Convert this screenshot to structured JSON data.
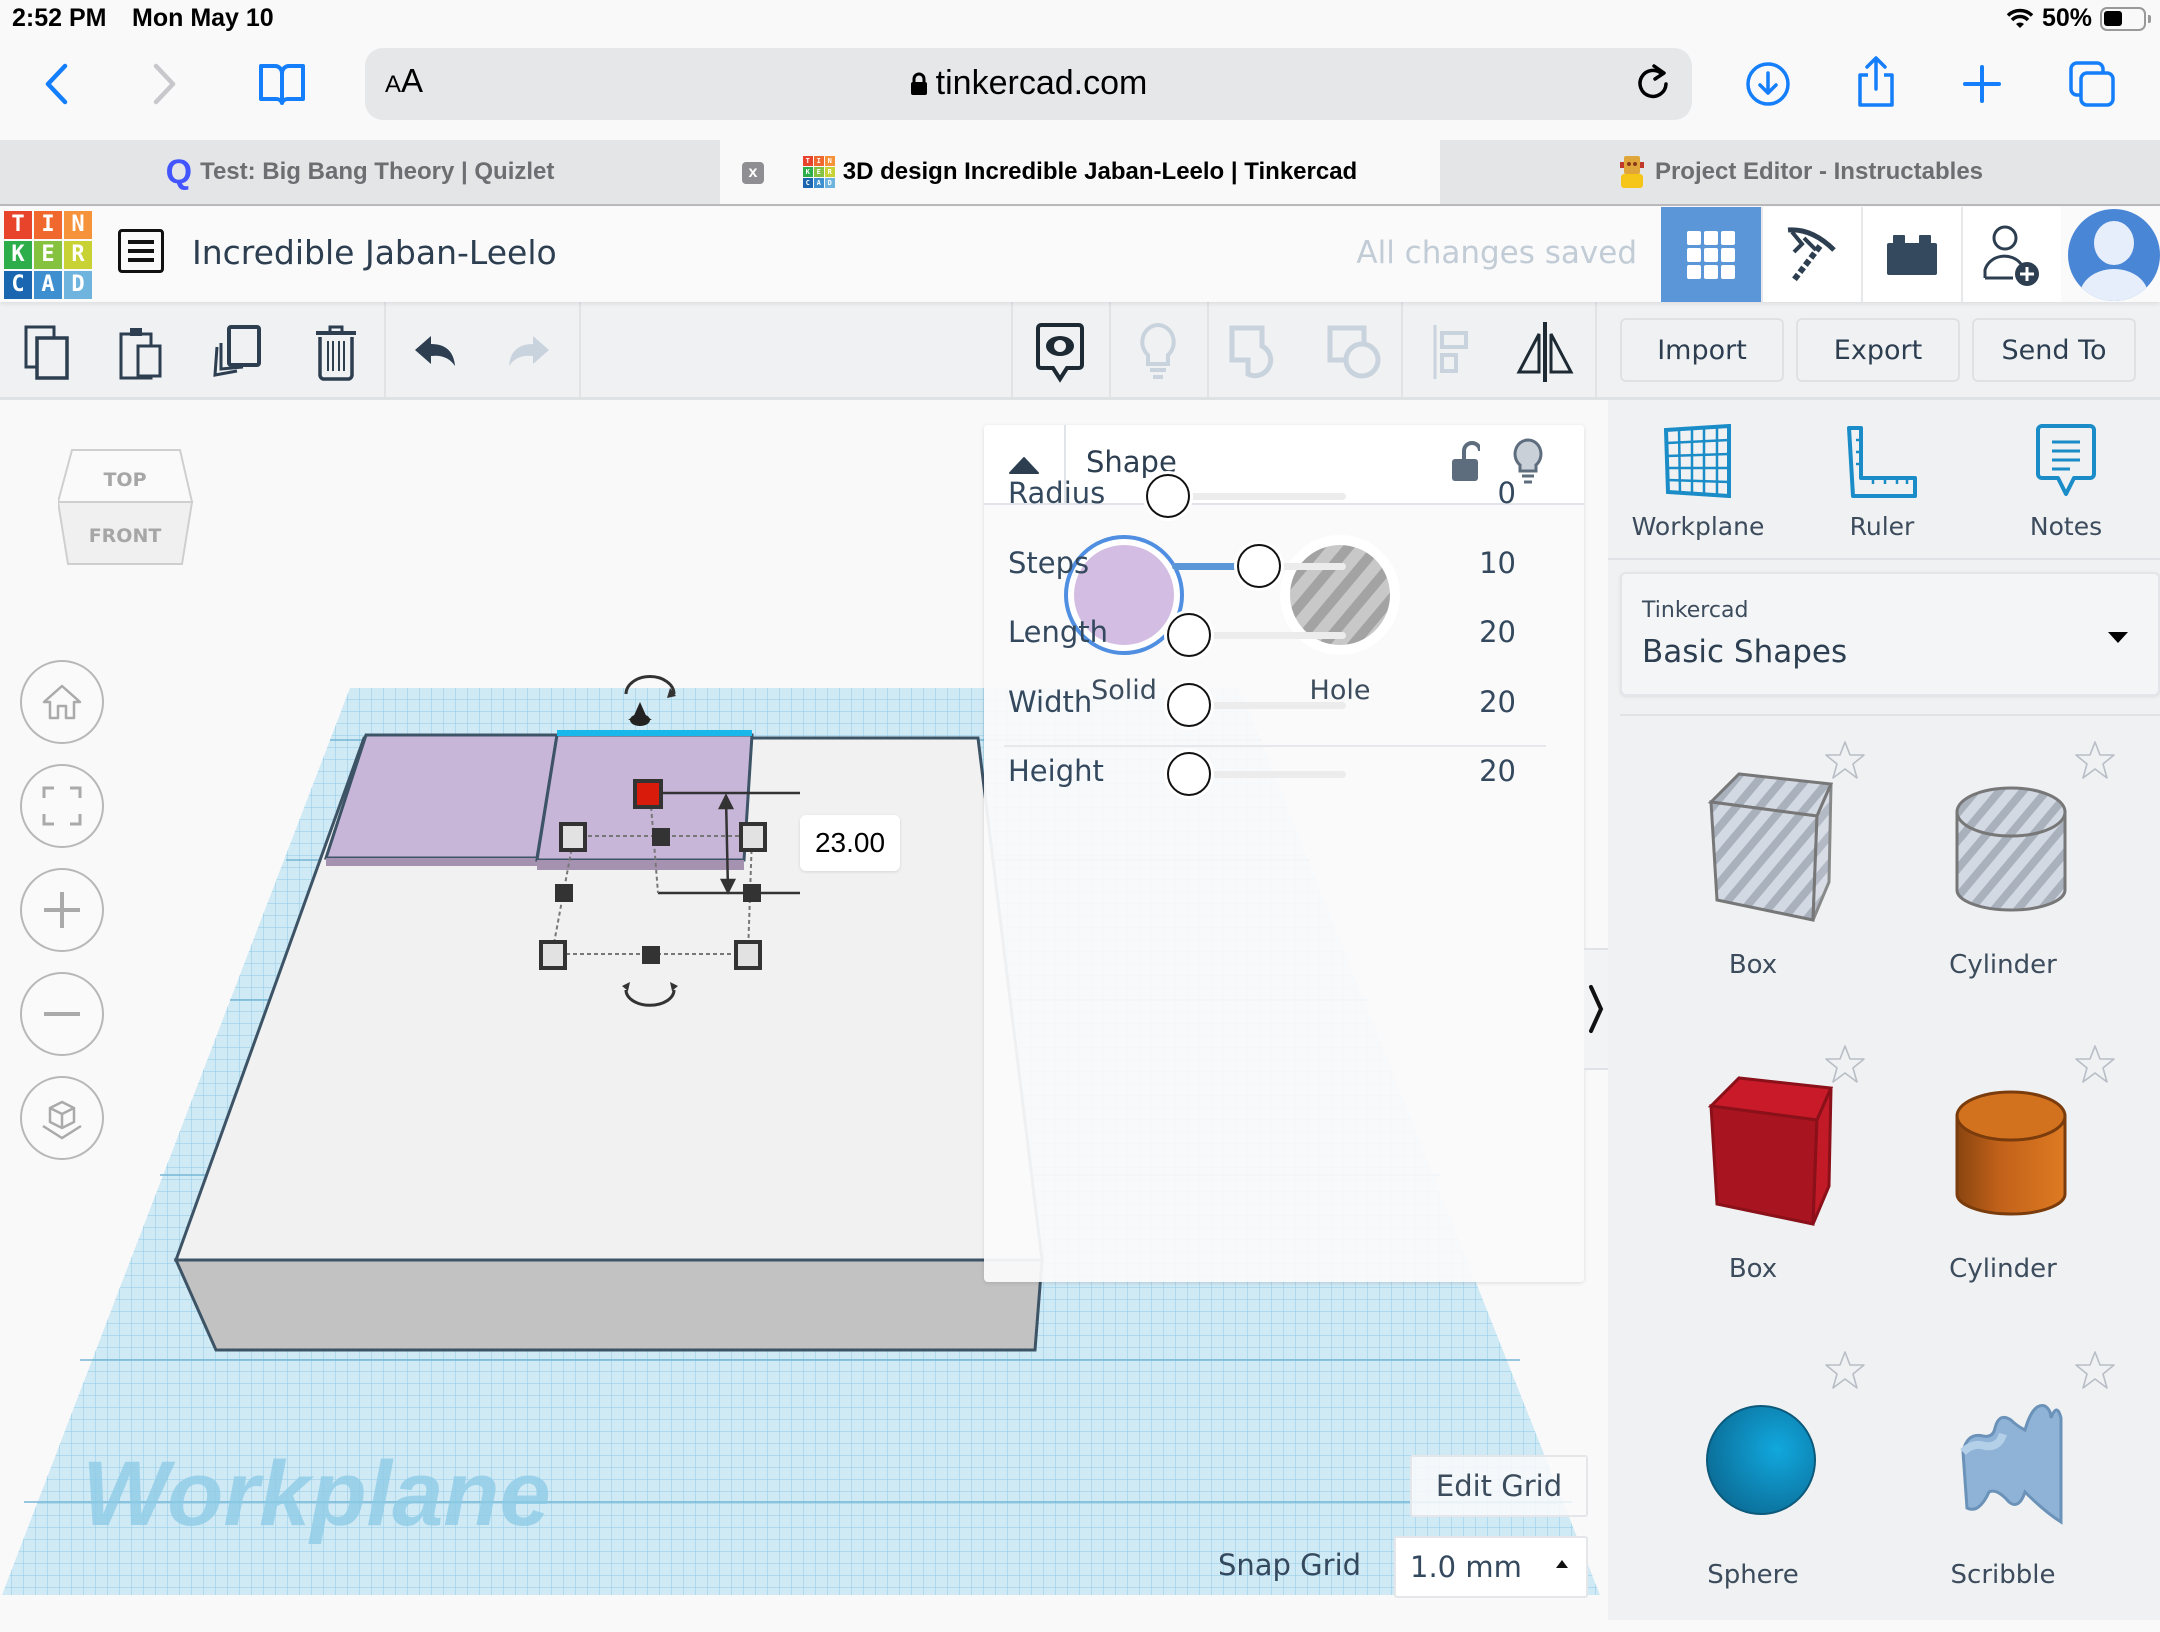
{
  "status_bar": {
    "time": "2:52 PM",
    "date": "Mon May 10",
    "battery": "50%",
    "icons": [
      "wifi-icon",
      "battery-icon"
    ]
  },
  "browser": {
    "text_size_button": {
      "small": "A",
      "large": "A"
    },
    "url": "tinkercad.com",
    "icons": {
      "back": "chevron-left-icon",
      "forward": "chevron-right-icon",
      "bookmarks": "book-icon",
      "secure": "lock-icon",
      "reload": "reload-icon",
      "downloads": "download-icon",
      "share": "share-icon",
      "new_tab": "plus-icon",
      "tabs": "tabs-icon"
    },
    "tabs": [
      {
        "title": "Test: Big Bang Theory | Quizlet",
        "favicon": "Q",
        "active": false
      },
      {
        "title": "3D design Incredible Jaban-Leelo | Tinkercad",
        "favicon": "tinkercad",
        "active": true,
        "close": "x"
      },
      {
        "title": "Project Editor - Instructables",
        "favicon": "instructables-robot",
        "active": false
      }
    ]
  },
  "app": {
    "logo_letters": [
      "T",
      "I",
      "N",
      "K",
      "E",
      "R",
      "C",
      "A",
      "D"
    ],
    "logo_colors": [
      "#e8442c",
      "#f0682e",
      "#f6923a",
      "#2eae4a",
      "#85c23f",
      "#c8d234",
      "#1a66b0",
      "#3d8fcf",
      "#6fb4df"
    ],
    "design_title": "Incredible Jaban-Leelo",
    "save_status": "All changes saved",
    "header_buttons": [
      {
        "name": "3d-view",
        "icon": "grid-icon",
        "active": true
      },
      {
        "name": "codeblocks",
        "icon": "pickaxe-icon",
        "active": false
      },
      {
        "name": "bricks",
        "icon": "brick-icon",
        "active": false
      },
      {
        "name": "invite",
        "icon": "add-user-icon",
        "active": false
      }
    ],
    "accent_color": "#5b97d8"
  },
  "toolbar": {
    "left_tools": [
      "copy",
      "paste",
      "duplicate",
      "delete",
      "undo",
      "redo"
    ],
    "right_tools": [
      "notes-visibility",
      "light",
      "group",
      "ungroup",
      "align",
      "mirror"
    ],
    "import_label": "Import",
    "export_label": "Export",
    "send_to_label": "Send To"
  },
  "viewport": {
    "viewcube": {
      "top": "TOP",
      "front": "FRONT"
    },
    "nav_buttons": [
      "home",
      "fit-all",
      "zoom-in",
      "zoom-out",
      "ortho-view"
    ],
    "dimension_value": "23.00",
    "workplane_watermark": "Workplane",
    "edit_grid_label": "Edit Grid",
    "snap_grid_label": "Snap Grid",
    "snap_grid_value": "1.0 mm"
  },
  "shape_panel": {
    "title": "Shape",
    "solid_label": "Solid",
    "hole_label": "Hole",
    "solid_color": "#d4bde3",
    "selected_type": "Solid",
    "params": [
      {
        "label": "Radius",
        "value": "0",
        "fraction": 0.0
      },
      {
        "label": "Steps",
        "value": "10",
        "fraction": 0.5
      },
      {
        "label": "Length",
        "value": "20",
        "fraction": 0.1
      },
      {
        "label": "Width",
        "value": "20",
        "fraction": 0.1
      },
      {
        "label": "Height",
        "value": "20",
        "fraction": 0.1
      }
    ]
  },
  "sidebar": {
    "tools": [
      {
        "label": "Workplane",
        "icon": "workplane-icon"
      },
      {
        "label": "Ruler",
        "icon": "ruler-icon"
      },
      {
        "label": "Notes",
        "icon": "notes-icon"
      }
    ],
    "library_provider": "Tinkercad",
    "library_name": "Basic Shapes",
    "shapes": [
      {
        "label": "Box",
        "variant": "hole"
      },
      {
        "label": "Cylinder",
        "variant": "hole"
      },
      {
        "label": "Box",
        "variant": "red"
      },
      {
        "label": "Cylinder",
        "variant": "orange"
      },
      {
        "label": "Sphere",
        "variant": "blue"
      },
      {
        "label": "Scribble",
        "variant": "lightblue"
      }
    ]
  }
}
